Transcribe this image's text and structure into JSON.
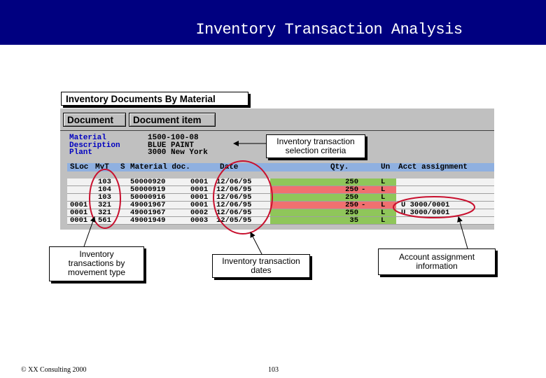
{
  "header": {
    "title": "Inventory Transaction Analysis"
  },
  "sap_screen": {
    "title": "Inventory Documents By Material",
    "toolbar": {
      "buttons": [
        "Document",
        "Document item"
      ]
    },
    "criteria": [
      {
        "label": "Material",
        "value": "1500-100-08"
      },
      {
        "label": "Description",
        "value": "BLUE PAINT"
      },
      {
        "label": "Plant",
        "value": "3000 New York"
      }
    ],
    "columns": {
      "sloc": "SLoc",
      "mvt": "MvT",
      "s": "S",
      "material_doc": "Material doc.",
      "date": "Date",
      "qty": "Qty.",
      "un": "Un",
      "acct": "Acct assignment"
    },
    "rows": [
      {
        "sloc": "",
        "mvt": "103",
        "doc": "50000920",
        "item": "0001",
        "date": "12/06/95",
        "qty": "250",
        "sign": "",
        "un": "L",
        "acct": "",
        "status": "green"
      },
      {
        "sloc": "",
        "mvt": "104",
        "doc": "50000919",
        "item": "0001",
        "date": "12/06/95",
        "qty": "250",
        "sign": "-",
        "un": "L",
        "acct": "",
        "status": "red"
      },
      {
        "sloc": "",
        "mvt": "103",
        "doc": "50000916",
        "item": "0001",
        "date": "12/06/95",
        "qty": "250",
        "sign": "",
        "un": "L",
        "acct": "",
        "status": "green"
      },
      {
        "sloc": "0001",
        "mvt": "321",
        "doc": "49001967",
        "item": "0001",
        "date": "12/06/95",
        "qty": "250",
        "sign": "-",
        "un": "L",
        "acct": "U 3000/0001",
        "status": "red"
      },
      {
        "sloc": "0001",
        "mvt": "321",
        "doc": "49001967",
        "item": "0002",
        "date": "12/06/95",
        "qty": "250",
        "sign": "",
        "un": "L",
        "acct": "U 3000/0001",
        "status": "green"
      },
      {
        "sloc": "0001",
        "mvt": "561",
        "doc": "49001949",
        "item": "0003",
        "date": "12/05/95",
        "qty": "35",
        "sign": "",
        "un": "L",
        "acct": "",
        "status": "green"
      }
    ]
  },
  "callouts": {
    "selection": "Inventory transaction selection criteria",
    "movement": "Inventory transactions by movement type",
    "dates": "Inventory transaction dates",
    "account": "Account assignment information"
  },
  "colors": {
    "banner": "#000080",
    "positive_row": "#8fc65a",
    "negative_row": "#f07070",
    "highlight_circle": "#c8102e"
  },
  "footer": {
    "copyright": "© XX Consulting 2000",
    "page": "103"
  }
}
